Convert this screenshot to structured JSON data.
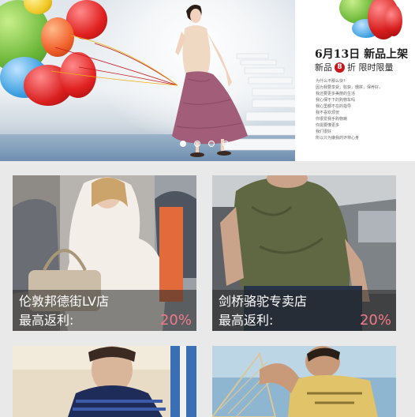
{
  "banner": {
    "date_headline": "6月13日 新品上架",
    "new_label": "新品",
    "discount_number": "8",
    "discount_suffix": "折 限时限量",
    "list_lines": [
      "为什么不那么快?",
      "因为我要享受，收获，珊拼，保养好，",
      "我还要更多美丽的生活",
      "我心保不下的购物车吗",
      "我心里都不在的指导",
      "我不喜欢烦怳",
      "你很爱我手购物喇",
      "你需要懂更多",
      "我们很好",
      "所以只为嫌我的诈林心身"
    ],
    "slide_count": 4,
    "active_slide": 0
  },
  "stores": [
    {
      "name": "伦敦邦德街LV店",
      "rebate_label": "最高返利:",
      "rebate": "20%"
    },
    {
      "name": "剑桥骆驼专卖店",
      "rebate_label": "最高返利:",
      "rebate": "20%"
    }
  ],
  "colors": {
    "rebate": "#f07a8a",
    "discount_badge": "#c8161d",
    "page_bg": "#e9e9e9"
  }
}
